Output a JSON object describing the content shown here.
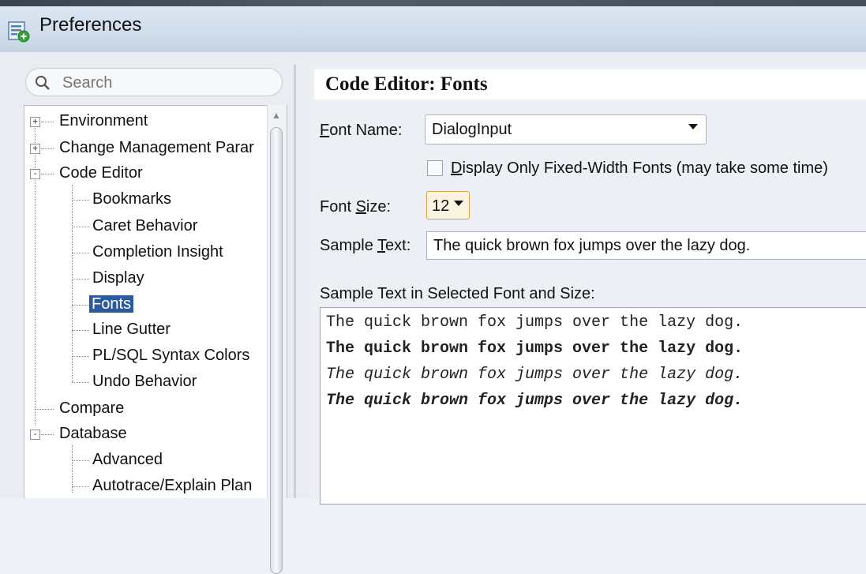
{
  "window": {
    "title": "Preferences",
    "icon": "preferences-app-icon"
  },
  "search": {
    "placeholder": "Search"
  },
  "tree": {
    "items": [
      {
        "label": "Environment",
        "level": 0,
        "expander": "+"
      },
      {
        "label": "Change Management Parar",
        "level": 0,
        "expander": "+"
      },
      {
        "label": "Code Editor",
        "level": 0,
        "expander": "-"
      },
      {
        "label": "Bookmarks",
        "level": 1
      },
      {
        "label": "Caret Behavior",
        "level": 1
      },
      {
        "label": "Completion Insight",
        "level": 1
      },
      {
        "label": "Display",
        "level": 1
      },
      {
        "label": "Fonts",
        "level": 1,
        "selected": true
      },
      {
        "label": "Line Gutter",
        "level": 1
      },
      {
        "label": "PL/SQL Syntax Colors",
        "level": 1
      },
      {
        "label": "Undo Behavior",
        "level": 1
      },
      {
        "label": "Compare",
        "level": 0
      },
      {
        "label": "Database",
        "level": 0,
        "expander": "-"
      },
      {
        "label": "Advanced",
        "level": 1
      },
      {
        "label": "Autotrace/Explain Plan",
        "level": 1
      }
    ]
  },
  "panel": {
    "title": "Code Editor: Fonts",
    "font_name_label": "Font Name:",
    "font_name_mnemonic": "F",
    "font_name_rest": "ont Name:",
    "font_name_value": "DialogInput",
    "fixed_width_checkbox": {
      "checked": false,
      "mnemonic": "D",
      "rest": "isplay Only Fixed-Width Fonts (may take some time)",
      "label": "Display Only Fixed-Width Fonts (may take some time)"
    },
    "font_size_label": "Font Size:",
    "font_size_prefix": "Font ",
    "font_size_mnemonic": "S",
    "font_size_rest": "ize:",
    "font_size_value": "12",
    "sample_text_label": "Sample Text:",
    "sample_text_prefix": "Sample ",
    "sample_text_mnemonic": "T",
    "sample_text_rest": "ext:",
    "sample_text_value": "The quick brown fox jumps over the lazy dog.",
    "preview_label": "Sample Text in Selected Font and Size:",
    "preview_lines": [
      {
        "text": "The quick brown fox jumps over the lazy dog.",
        "style": "plain"
      },
      {
        "text": "The quick brown fox jumps over the lazy dog.",
        "style": "bold"
      },
      {
        "text": "The quick brown fox jumps over the lazy dog.",
        "style": "italic"
      },
      {
        "text": "The quick brown fox jumps over the lazy dog.",
        "style": "bold-italic"
      }
    ]
  },
  "colors": {
    "selection": "#2c5aa0",
    "titlebar": "#d3dfec"
  }
}
